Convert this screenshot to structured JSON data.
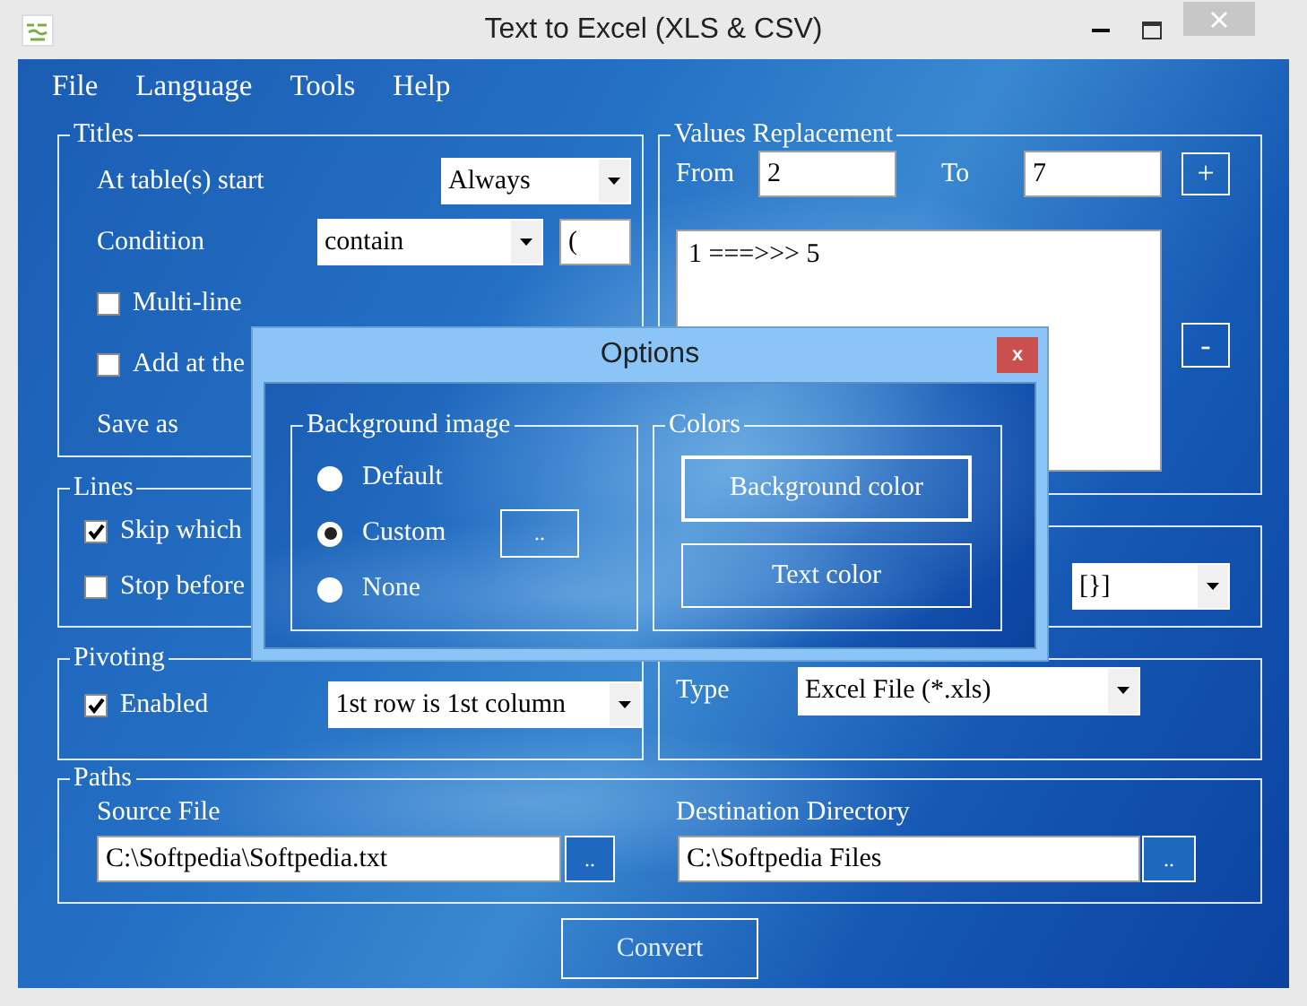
{
  "window": {
    "title": "Text to Excel (XLS & CSV)"
  },
  "menu": [
    "File",
    "Language",
    "Tools",
    "Help"
  ],
  "titles": {
    "label": "Titles",
    "at_table_start": {
      "label": "At table(s) start",
      "value": "Always"
    },
    "condition": {
      "label": "Condition",
      "value": "contain",
      "text": "("
    },
    "options": [
      {
        "label": "Multi-line",
        "checked": false
      },
      {
        "label": "Add at the",
        "checked": false
      }
    ],
    "save_as": {
      "label": "Save as"
    }
  },
  "values_replacement": {
    "label": "Values Replacement",
    "from_label": "From",
    "from": "2",
    "to_label": "To",
    "to": "7",
    "add_button": "+",
    "list": [
      "1 ===>>> 5"
    ],
    "remove_button": "-"
  },
  "lines": {
    "label": "Lines",
    "options": [
      {
        "label": "Skip which",
        "checked": true
      },
      {
        "label": "Stop before",
        "checked": false
      }
    ]
  },
  "group_3": {
    "value": "[}]"
  },
  "pivoting": {
    "label": "Pivoting",
    "enabled": {
      "label": "Enabled",
      "checked": true
    },
    "mode": "1st row is 1st column"
  },
  "output": {
    "type_label": "Type",
    "type": "Excel File (*.xls)"
  },
  "paths": {
    "label": "Paths",
    "source": {
      "label": "Source File",
      "value": "C:\\Softpedia\\Softpedia.txt",
      "browse": ".."
    },
    "destination": {
      "label": "Destination Directory",
      "value": "C:\\Softpedia Files",
      "browse": ".."
    }
  },
  "convert_button": "Convert",
  "options_dialog": {
    "title": "Options",
    "close": "x",
    "background_image": {
      "label": "Background image",
      "options": [
        {
          "label": "Default",
          "selected": false
        },
        {
          "label": "Custom",
          "selected": true
        },
        {
          "label": "None",
          "selected": false
        }
      ],
      "browse": ".."
    },
    "colors": {
      "label": "Colors",
      "buttons": [
        {
          "label": "Background color",
          "focused": true
        },
        {
          "label": "Text color",
          "focused": false
        }
      ]
    }
  }
}
